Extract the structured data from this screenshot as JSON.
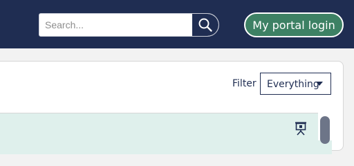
{
  "header": {
    "search": {
      "placeholder": "Search...",
      "value": "",
      "button_icon": "search-icon"
    },
    "portal_button": {
      "label": "My portal login"
    }
  },
  "toolbar": {
    "filter_label": "Filter",
    "filter_selected": "Everything",
    "filter_caret_icon": "caret-down-icon"
  },
  "list": {
    "rows": [
      {
        "icon": "presentation-icon"
      }
    ]
  },
  "colors": {
    "header_bg": "#1f2d52",
    "portal_button_bg": "#3d8164",
    "row_highlight": "#dff0ec"
  }
}
